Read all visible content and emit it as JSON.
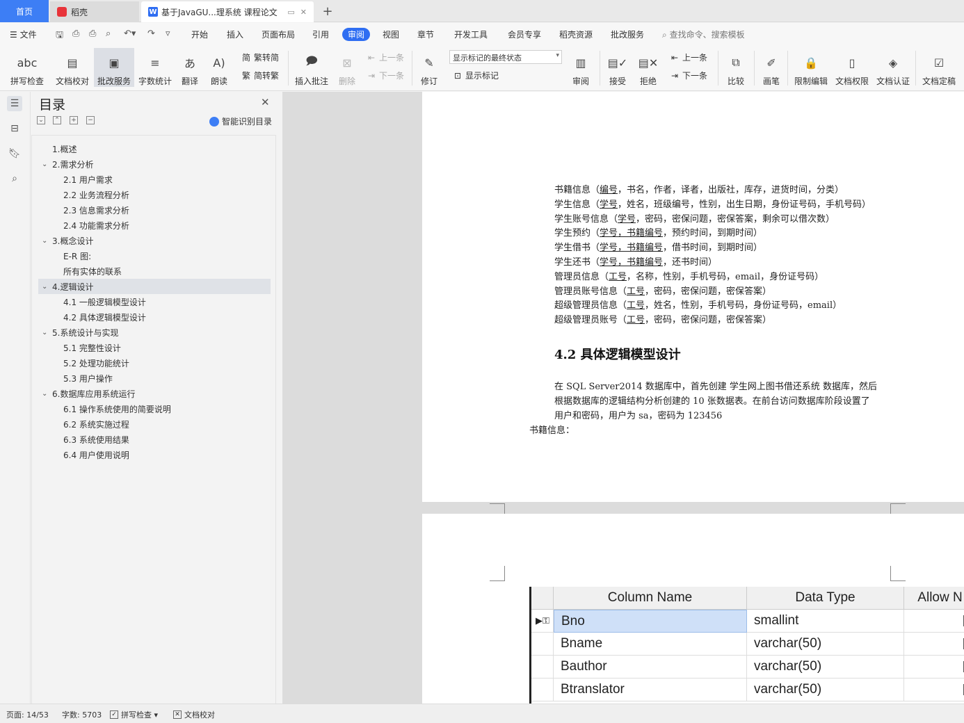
{
  "tabs": {
    "home": "首页",
    "docer": "稻壳",
    "doc": "基于JavaGU...理系统 课程论文",
    "add_icon": "plus-icon"
  },
  "menu": {
    "file": "文件",
    "items": [
      "开始",
      "插入",
      "页面布局",
      "引用",
      "审阅",
      "视图",
      "章节",
      "开发工具",
      "会员专享",
      "稻壳资源",
      "批改服务"
    ],
    "active": "审阅",
    "search": "查找命令、搜索模板"
  },
  "ribbon": {
    "spell": "拼写检查",
    "doccheck": "文档校对",
    "review_service": "批改服务",
    "wordcount": "字数统计",
    "translate": "翻译",
    "read": "朗读",
    "trad": "繁转简",
    "simp": "简转繁",
    "insert_comment": "插入批注",
    "delete": "删除",
    "prev": "上一条",
    "next": "下一条",
    "revise": "修订",
    "markup_state": "显示标记的最终状态",
    "show_markup": "显示标记",
    "review": "审阅",
    "accept": "接受",
    "reject": "拒绝",
    "prev2": "上一条",
    "next2": "下一条",
    "compare": "比较",
    "pen": "画笔",
    "restrict": "限制编辑",
    "permission": "文档权限",
    "certify": "文档认证",
    "finalize": "文档定稿"
  },
  "toc": {
    "title": "目录",
    "ai": "智能识别目录",
    "items": [
      {
        "label": "1.概述",
        "level": 1,
        "chev": false
      },
      {
        "label": "2.需求分析",
        "level": 1,
        "chev": true
      },
      {
        "label": "2.1 用户需求",
        "level": 2,
        "chev": false
      },
      {
        "label": "2.2 业务流程分析",
        "level": 2,
        "chev": false
      },
      {
        "label": "2.3 信息需求分析",
        "level": 2,
        "chev": false
      },
      {
        "label": "2.4 功能需求分析",
        "level": 2,
        "chev": false
      },
      {
        "label": "3.概念设计",
        "level": 1,
        "chev": true
      },
      {
        "label": "E-R 图:",
        "level": 2,
        "chev": false
      },
      {
        "label": "所有实体的联系",
        "level": 2,
        "chev": false
      },
      {
        "label": "4.逻辑设计",
        "level": 1,
        "chev": true,
        "selected": true
      },
      {
        "label": "4.1 一般逻辑模型设计",
        "level": 2,
        "chev": false
      },
      {
        "label": "4.2 具体逻辑模型设计",
        "level": 2,
        "chev": false
      },
      {
        "label": "5.系统设计与实现",
        "level": 1,
        "chev": true
      },
      {
        "label": "5.1 完整性设计",
        "level": 2,
        "chev": false
      },
      {
        "label": "5.2 处理功能统计",
        "level": 2,
        "chev": false
      },
      {
        "label": "5.3 用户操作",
        "level": 2,
        "chev": false
      },
      {
        "label": "6.数据库应用系统运行",
        "level": 1,
        "chev": true
      },
      {
        "label": "6.1 操作系统使用的简要说明",
        "level": 2,
        "chev": false
      },
      {
        "label": "6.2 系统实施过程",
        "level": 2,
        "chev": false
      },
      {
        "label": "6.3 系统使用结果",
        "level": 2,
        "chev": false
      },
      {
        "label": "6.4 用户使用说明",
        "level": 2,
        "chev": false
      }
    ]
  },
  "doc": {
    "lines": [
      [
        {
          "t": "书籍信息（"
        },
        {
          "t": "编号",
          "u": true
        },
        {
          "t": "，书名，作者，译者，出版社，库存，进货时间，分类）"
        }
      ],
      [
        {
          "t": "学生信息（"
        },
        {
          "t": "学号",
          "u": true
        },
        {
          "t": "，姓名，班级编号，性别，出生日期，身份证号码，手机号码）"
        }
      ],
      [
        {
          "t": "学生账号信息（"
        },
        {
          "t": "学号",
          "u": true
        },
        {
          "t": "，密码，密保问题，密保答案，剩余可以借次数）"
        }
      ],
      [
        {
          "t": "学生预约（"
        },
        {
          "t": "学号，书籍编号",
          "u": true
        },
        {
          "t": "，预约时间，到期时间）"
        }
      ],
      [
        {
          "t": "学生借书（"
        },
        {
          "t": "学号，书籍编号",
          "u": true
        },
        {
          "t": "，借书时间，到期时间）"
        }
      ],
      [
        {
          "t": "学生还书（"
        },
        {
          "t": "学号，书籍编号",
          "u": true
        },
        {
          "t": "，还书时间）"
        }
      ],
      [
        {
          "t": "管理员信息（"
        },
        {
          "t": "工号",
          "u": true
        },
        {
          "t": "，名称，性别，手机号码，email，身份证号码）"
        }
      ],
      [
        {
          "t": "管理员账号信息（"
        },
        {
          "t": "工号",
          "u": true
        },
        {
          "t": "，密码，密保问题，密保答案）"
        }
      ],
      [
        {
          "t": "超级管理员信息（"
        },
        {
          "t": "工号",
          "u": true
        },
        {
          "t": "，姓名，性别，手机号码，身份证号码，email）"
        }
      ],
      [
        {
          "t": "超级管理员账号（"
        },
        {
          "t": "工号",
          "u": true
        },
        {
          "t": "，密码，密保问题，密保答案）"
        }
      ]
    ],
    "heading": "4.2 具体逻辑模型设计",
    "para": [
      "在 SQL Server2014 数据库中，首先创建 学生网上图书借还系统 数据库，然后",
      "根据数据库的逻辑结构分析创建的 10 张数据表。在前台访问数据库阶段设置了",
      "用户和密码，用户为 sa，密码为 123456"
    ],
    "book_label": "书籍信息："
  },
  "sql_table": {
    "headers": [
      "Column Name",
      "Data Type",
      "Allow N"
    ],
    "rows": [
      {
        "name": "Bno",
        "type": "smallint",
        "allow": false,
        "key": true
      },
      {
        "name": "Bname",
        "type": "varchar(50)",
        "allow": false
      },
      {
        "name": "Bauthor",
        "type": "varchar(50)",
        "allow": false
      },
      {
        "name": "Btranslator",
        "type": "varchar(50)",
        "allow": true
      }
    ]
  },
  "status": {
    "page": "页面: 14/53",
    "words": "字数: 5703",
    "spell": "拼写检查",
    "doccheck": "文档校对"
  }
}
